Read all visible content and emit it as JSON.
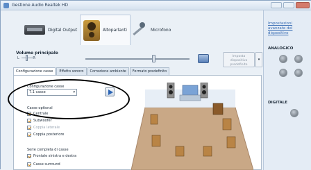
{
  "window": {
    "title": "Gestione Audio Realtek HD"
  },
  "device_tabs": [
    {
      "label": "Digital Output",
      "icon": "digital-output-icon"
    },
    {
      "label": "Altoparlanti",
      "icon": "speaker-icon",
      "active": true
    },
    {
      "label": "Microfono",
      "icon": "microphone-icon"
    }
  ],
  "volume": {
    "label": "Volume principale",
    "left": "L",
    "right": "R",
    "level": 0.66,
    "default_device_button": "Imposta dispositivo predefinito"
  },
  "sub_tabs": [
    {
      "label": "Configurazione casse",
      "active": true
    },
    {
      "label": "Effetto sonoro"
    },
    {
      "label": "Correzione ambiente"
    },
    {
      "label": "Formato predefinito"
    }
  ],
  "speaker_config": {
    "label": "Configurazione casse",
    "selected": "7.1 casse"
  },
  "optional_speakers": {
    "title": "Casse optional",
    "items": [
      {
        "label": "Centrale",
        "checked": true,
        "disabled": false
      },
      {
        "label": "Subwoofer",
        "checked": true,
        "disabled": false
      },
      {
        "label": "Coppia laterale",
        "checked": true,
        "disabled": true
      },
      {
        "label": "Coppia posteriore",
        "checked": true,
        "disabled": false
      }
    ]
  },
  "full_range": {
    "title": "Serie completa di casse",
    "items": [
      {
        "label": "Frontale sinistra e destra",
        "checked": true
      },
      {
        "label": "Casse surround",
        "checked": true
      }
    ]
  },
  "right_panel": {
    "link": "Impostazioni avanzate del dispositivo",
    "analog_title": "ANALOGICO",
    "digital_title": "DIGITALE"
  },
  "colors": {
    "accent": "#3a6eb5",
    "panel": "#e4ecf5",
    "floor": "#c9a886"
  }
}
